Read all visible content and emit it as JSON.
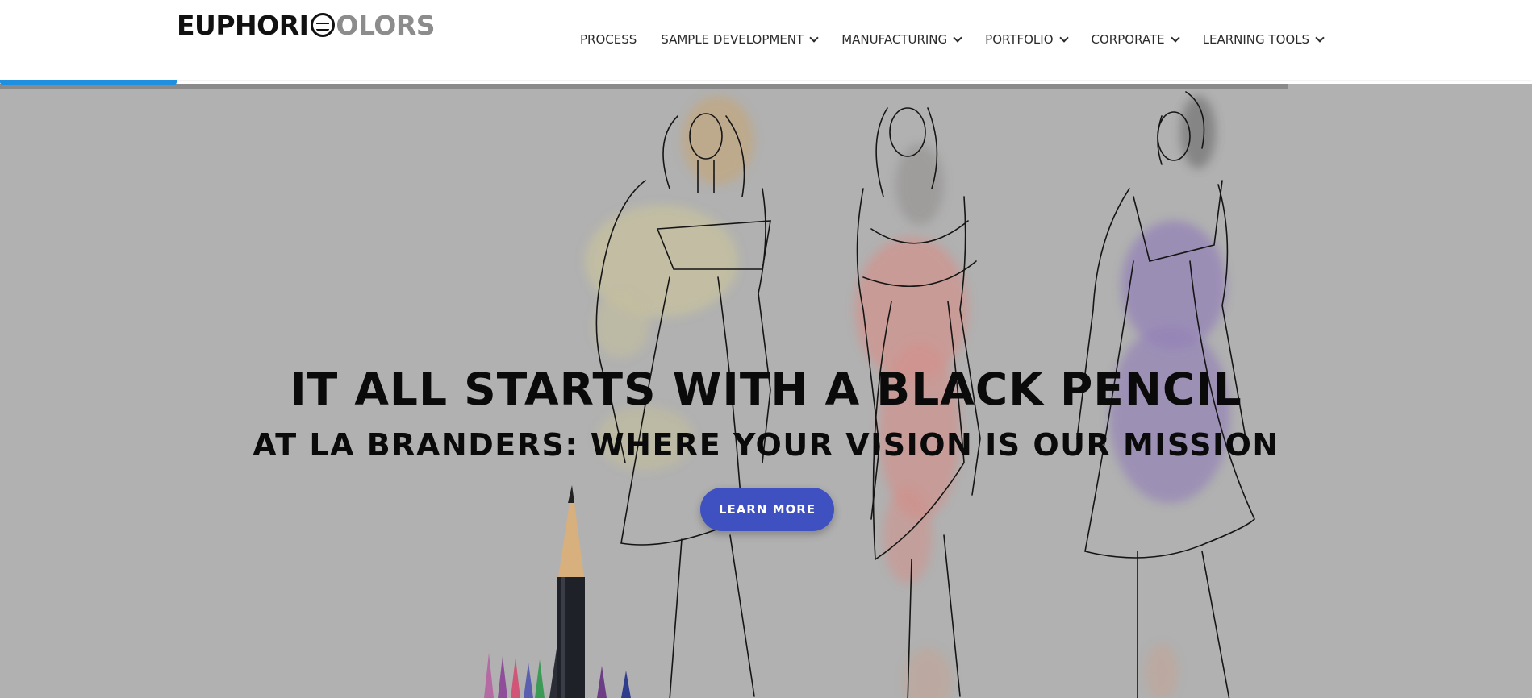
{
  "header": {
    "logo": {
      "part1": "EUPHORI",
      "part2": "OLORS"
    },
    "nav": [
      {
        "label": "PROCESS",
        "has_dropdown": false
      },
      {
        "label": "SAMPLE DEVELOPMENT",
        "has_dropdown": true
      },
      {
        "label": "MANUFACTURING",
        "has_dropdown": true
      },
      {
        "label": "PORTFOLIO",
        "has_dropdown": true
      },
      {
        "label": "CORPORATE",
        "has_dropdown": true
      },
      {
        "label": "LEARNING TOOLS",
        "has_dropdown": true
      }
    ]
  },
  "hero": {
    "title": "IT ALL STARTS WITH A BLACK PENCIL",
    "subtitle": "AT LA BRANDERS: WHERE YOUR VISION IS OUR MISSION",
    "cta_label": "LEARN MORE",
    "illustration": "fashion-sketch-three-models-with-colored-pencils"
  },
  "colors": {
    "accent": "#3f51c1",
    "progress": "#1f8fe0",
    "hero_bg": "#b1b1b1",
    "logo_light": "#8c8c8c"
  }
}
